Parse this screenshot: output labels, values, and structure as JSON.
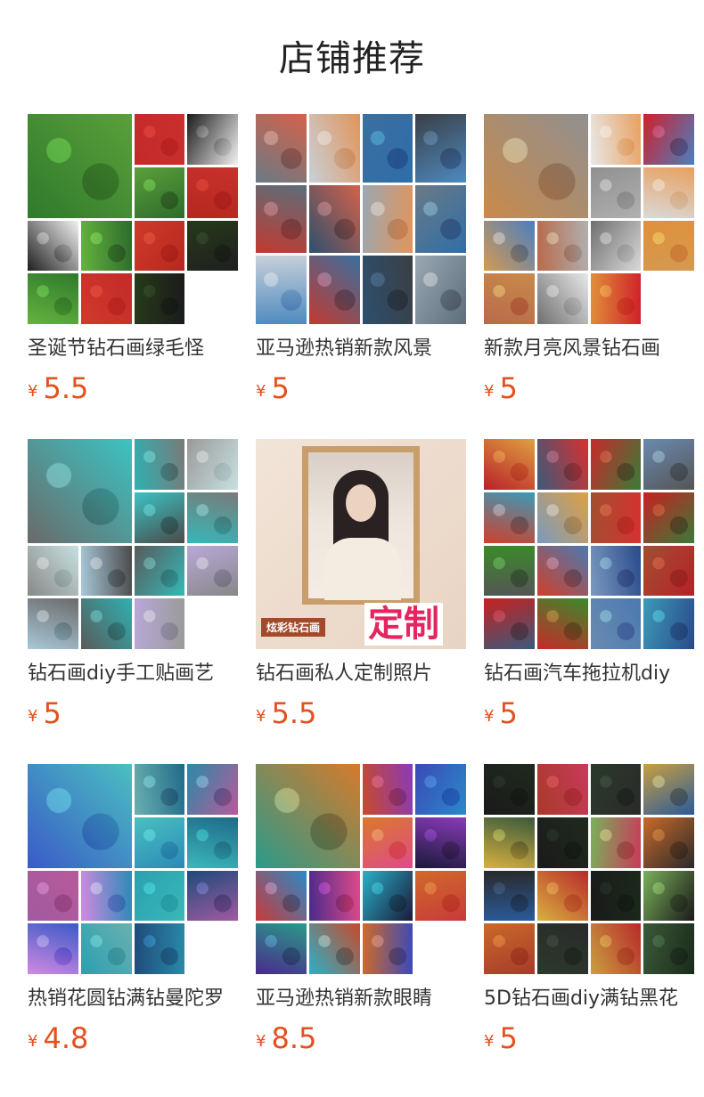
{
  "page": {
    "title": "店铺推荐"
  },
  "currency_symbol": "¥",
  "products": [
    {
      "name": "圣诞节钻石画绿毛怪",
      "price": "5.5",
      "thumb_layout": "mix",
      "colors": [
        "#2f7a2c",
        "#c42a2a",
        "#1b1b1b",
        "#5aa03a",
        "#c9302c",
        "#f2f2f2",
        "#2d6b2b",
        "#b5281f",
        "#1f1f1f",
        "#65b33f",
        "#d03a2a",
        "#263a1a"
      ],
      "icon": "grinch-christmas-image"
    },
    {
      "name": "亚马逊热销新款风景",
      "price": "5",
      "thumb_layout": "4x3",
      "colors": [
        "#6a7a85",
        "#c8d0d8",
        "#3a6fa0",
        "#3a3f45",
        "#5c6e7a",
        "#d4624a",
        "#e2945a",
        "#2f6ea8",
        "#4e8ac0",
        "#c23a30",
        "#2e4f6e",
        "#9aa8b3"
      ],
      "icon": "lighthouse-image"
    },
    {
      "name": "新款月亮风景钻石画",
      "price": "5",
      "thumb_layout": "mix",
      "colors": [
        "#c98a4a",
        "#e8e8e8",
        "#d0202a",
        "#909090",
        "#e9a060",
        "#4a7fc0",
        "#b0b0b0",
        "#d9d9d9",
        "#d49a52",
        "#b86a4a",
        "#6f6f6f",
        "#e0903a"
      ],
      "icon": "moon-landscape-image"
    },
    {
      "name": "钻石画diy手工贴画艺",
      "price": "5",
      "thumb_layout": "mix",
      "colors": [
        "#6a6a6a",
        "#2fb0b0",
        "#9a9a9a",
        "#3cc3c3",
        "#7a7a7a",
        "#c8e0e0",
        "#4a4a4a",
        "#35b8b8",
        "#888888",
        "#a8c8d8",
        "#5a5a5a",
        "#b8a8d8"
      ],
      "icon": "teal-flower-image"
    },
    {
      "name": "钻石画私人定制照片",
      "price": "5.5",
      "thumb_layout": "portrait",
      "brand_tag": "炫彩钻石画",
      "custom_tag": "定制",
      "icon": "custom-portrait-image"
    },
    {
      "name": "钻石画汽车拖拉机diy",
      "price": "5",
      "thumb_layout": "4x4",
      "colors": [
        "#b8202a",
        "#3a5a7a",
        "#c82a2a",
        "#6a8ab0",
        "#3c9ab8",
        "#e0a040",
        "#d83030",
        "#3a7a3a",
        "#555555",
        "#d0402a",
        "#7a9ac0",
        "#a05030",
        "#c82020",
        "#3a8a2a",
        "#4a7ab0",
        "#2a4a8a"
      ],
      "icon": "vintage-truck-image"
    },
    {
      "name": "热销花圆钻满钻曼陀罗",
      "price": "4.8",
      "thumb_layout": "mix",
      "colors": [
        "#3a5ac8",
        "#6ab0b0",
        "#2a8aa8",
        "#4ac0c0",
        "#1f6a8a",
        "#b85a9a",
        "#2a8ab8",
        "#3ab8b8",
        "#a05aa0",
        "#d08ae0",
        "#2aa0b0",
        "#1f4a7a"
      ],
      "icon": "mandala-image"
    },
    {
      "name": "亚马逊热销新款眼睛",
      "price": "8.5",
      "thumb_layout": "mix",
      "colors": [
        "#2a9a8a",
        "#c84a2a",
        "#3a4ab8",
        "#d87a2a",
        "#8a3ab8",
        "#2a8ac8",
        "#e04a8a",
        "#1a1a3a",
        "#c83a3a",
        "#4a2a8a",
        "#2ab0c8",
        "#d06a2a"
      ],
      "icon": "psychedelic-eye-image"
    },
    {
      "name": "5D钻石画diy满钻黑花",
      "price": "5",
      "thumb_layout": "4x4",
      "colors": [
        "#1a1a1a",
        "#a83a2a",
        "#2a3a2a",
        "#c8a040",
        "#3a5a3a",
        "#1f2a1f",
        "#c83a5a",
        "#2a2a2a",
        "#2a5a9a",
        "#d8b040",
        "#1a1a1a",
        "#7ab05a",
        "#c86a2a",
        "#2a2a2a",
        "#b82a2a",
        "#1a2a1a"
      ],
      "icon": "black-flower-moth-image"
    }
  ]
}
